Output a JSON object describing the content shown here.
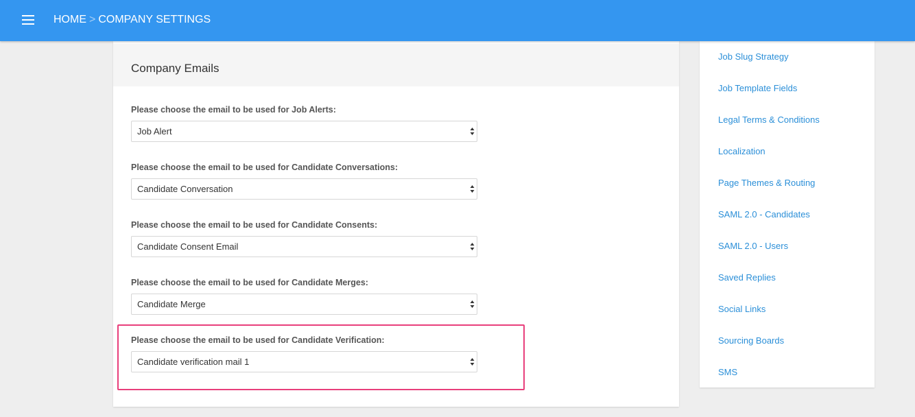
{
  "header": {
    "breadcrumb_home": "HOME",
    "breadcrumb_separator": ">",
    "breadcrumb_current": "COMPANY SETTINGS",
    "bar_color": "#3496f0",
    "menu_icon": "hamburger-menu-icon"
  },
  "main": {
    "title": "Company Emails",
    "fields": [
      {
        "label": "Please choose the email to be used for Job Alerts:",
        "value": "Job Alert"
      },
      {
        "label": "Please choose the email to be used for Candidate Conversations:",
        "value": "Candidate Conversation"
      },
      {
        "label": "Please choose the email to be used for Candidate Consents:",
        "value": "Candidate Consent Email"
      },
      {
        "label": "Please choose the email to be used for Candidate Merges:",
        "value": "Candidate Merge"
      },
      {
        "label": "Please choose the email to be used for Candidate Verification:",
        "value": "Candidate verification mail 1"
      }
    ],
    "highlight_color": "#e83e7b"
  },
  "sidebar": {
    "link_color": "#2b8fd8",
    "items": [
      "Job Slug Strategy",
      "Job Template Fields",
      "Legal Terms & Conditions",
      "Localization",
      "Page Themes & Routing",
      "SAML 2.0 - Candidates",
      "SAML 2.0 - Users",
      "Saved Replies",
      "Social Links",
      "Sourcing Boards",
      "SMS"
    ]
  }
}
